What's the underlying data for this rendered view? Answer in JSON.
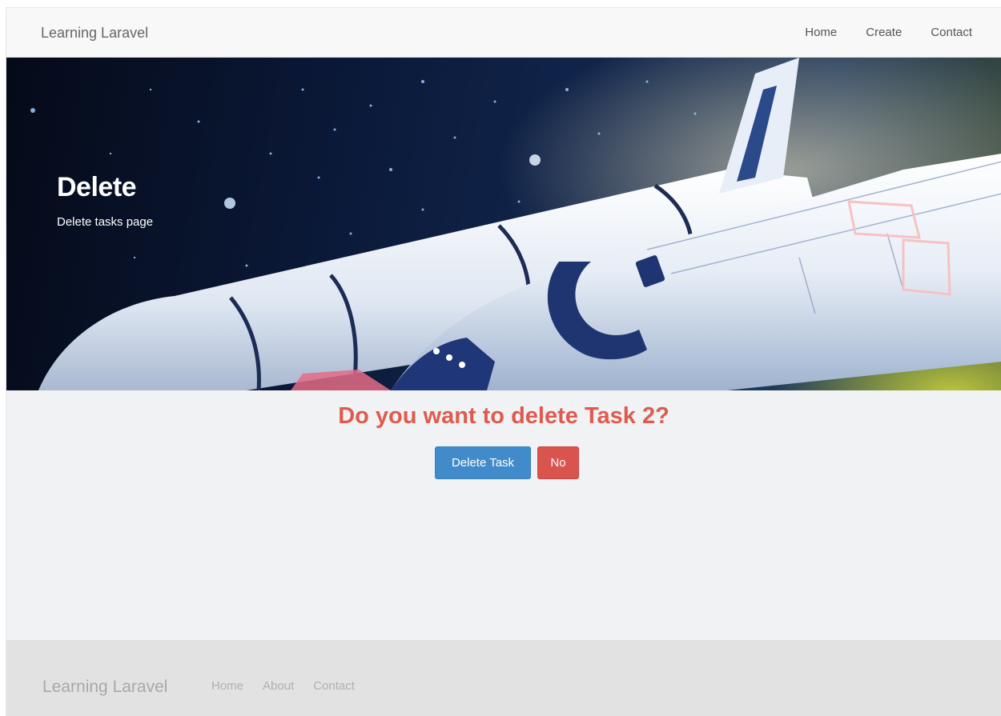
{
  "navbar": {
    "brand": "Learning Laravel",
    "links": [
      "Home",
      "Create",
      "Contact"
    ]
  },
  "hero": {
    "title": "Delete",
    "subtitle": "Delete tasks page"
  },
  "main": {
    "question": "Do you want to delete Task 2?",
    "delete_label": "Delete Task",
    "no_label": "No"
  },
  "footer": {
    "brand": "Learning Laravel",
    "links": [
      "Home",
      "About",
      "Contact"
    ]
  },
  "colors": {
    "question": "#e05a4e",
    "primary": "#428bca",
    "danger": "#d9534f",
    "footer_bg": "#e2e2e2"
  }
}
